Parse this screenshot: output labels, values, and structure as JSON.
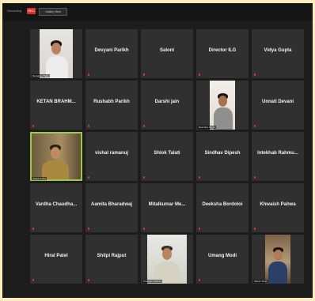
{
  "toolbar": {
    "label": "Recording",
    "rec_button": "REC",
    "view_button": "Gallery View"
  },
  "tiles": [
    {
      "name": "",
      "caption": "Ramaraju Babu"
    },
    {
      "name": "Devyani Parikh"
    },
    {
      "name": "Saloni"
    },
    {
      "name": "Director ILG"
    },
    {
      "name": "Vidya Gupta"
    },
    {
      "name": "KETAN BRAHM..."
    },
    {
      "name": "Rushabh Parikh"
    },
    {
      "name": "Darshi jain"
    },
    {
      "name": "",
      "caption": "Ravindra Singh"
    },
    {
      "name": "Unnati Devani"
    },
    {
      "name": "",
      "caption": "Shakti Sinha"
    },
    {
      "name": "vishal ramanuj"
    },
    {
      "name": "Shlok Talati"
    },
    {
      "name": "Sindhav Dipesh"
    },
    {
      "name": "Intekhab Rahmu..."
    },
    {
      "name": "Vardha Chaudha..."
    },
    {
      "name": "Aamita Bharadwaj"
    },
    {
      "name": "Mitalkumar Me..."
    },
    {
      "name": "Deeksha Bordoloi"
    },
    {
      "name": "Khwaish Pahwa"
    },
    {
      "name": "Hiral Patel"
    },
    {
      "name": "Shilpi Rajput"
    },
    {
      "name": "",
      "caption": "Prashant Sharma"
    },
    {
      "name": "Umang Modi"
    },
    {
      "name": "",
      "caption": "Mitesh Shah"
    }
  ]
}
